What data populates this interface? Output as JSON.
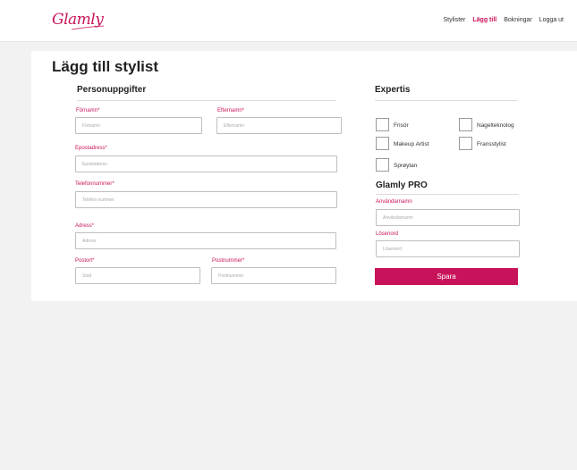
{
  "header": {
    "logo_text": "Glamly",
    "nav": [
      {
        "label": "Stylister",
        "active": false
      },
      {
        "label": "Lägg till",
        "active": true
      },
      {
        "label": "Bokningar",
        "active": false
      },
      {
        "label": "Logga ut",
        "active": false
      }
    ]
  },
  "page_title": "Lägg till stylist",
  "personal": {
    "title": "Personuppgifter",
    "firstname": {
      "label": "Förnamn*",
      "placeholder": "Förnamn",
      "value": ""
    },
    "lastname": {
      "label": "Efternamn*",
      "placeholder": "Efternamn",
      "value": ""
    },
    "email": {
      "label": "Epostadress*",
      "placeholder": "Epostadress",
      "value": ""
    },
    "phone": {
      "label": "Telefonnummer*",
      "placeholder": "Telefon nummer",
      "value": ""
    },
    "address": {
      "label": "Adress*",
      "placeholder": "Adress",
      "value": ""
    },
    "city": {
      "label": "Postort*",
      "placeholder": "Stad",
      "value": ""
    },
    "zip": {
      "label": "Postnummer*",
      "placeholder": "Postnummer",
      "value": ""
    }
  },
  "expertis": {
    "title": "Expertis",
    "options": [
      {
        "label": "Frisör",
        "checked": false
      },
      {
        "label": "Nagelteknolog",
        "checked": false
      },
      {
        "label": "Makeup Artist",
        "checked": false
      },
      {
        "label": "Fransstylist",
        "checked": false
      },
      {
        "label": "Sprøytan",
        "checked": false
      }
    ]
  },
  "pro": {
    "title": "Glamly PRO",
    "username": {
      "label": "Användarnamn",
      "placeholder": "Användarnamn",
      "value": ""
    },
    "password": {
      "label": "Lösenord",
      "placeholder": "Lösenord",
      "value": ""
    }
  },
  "save_label": "Spara",
  "colors": {
    "accent": "#c8135a",
    "background": "#f2f2f2",
    "card": "#ffffff"
  }
}
